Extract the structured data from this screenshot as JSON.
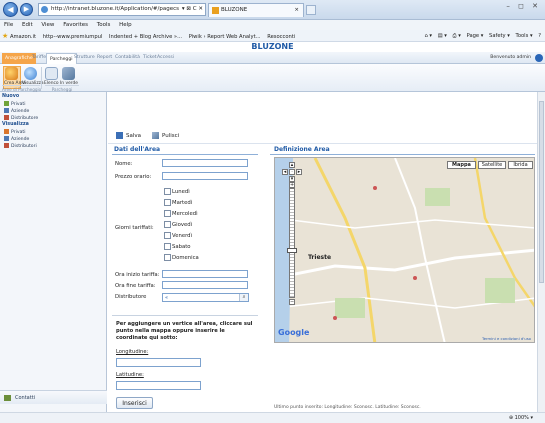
{
  "browser": {
    "address": "http://intranet.bluzone.it/Application/#/pagecs",
    "address_icons": "▾ ⊠ C ✕",
    "tab_title": "BLUZONE",
    "tab_close": "×",
    "window_controls": "– ◻ ✕",
    "menu": [
      "File",
      "Edit",
      "View",
      "Favorites",
      "Tools",
      "Help"
    ],
    "favorites": [
      "Amazon.it",
      "http--www.premiumpul",
      "Indented + Blog Archive »...",
      "Piwik › Report Web Analyt...",
      "Resocconti"
    ],
    "commands": [
      "Page ▾",
      "Safety ▾",
      "Tools ▾"
    ],
    "status_zoom": "⊕ 100% ▾"
  },
  "app": {
    "title": "BLUZONE",
    "ribbon_tabs": [
      "Anagrafiche",
      "Tariffe",
      "Parcheggi",
      "Strutture",
      "Report",
      "Contabilità",
      "Ticket",
      "Accessi"
    ],
    "welcome": "Benvenuto admin",
    "ribbon": {
      "buttons": [
        "Crea Area",
        "Visualizza",
        "Elenco",
        "In verde"
      ],
      "groups": [
        "Aree di Parcheggio",
        "Parcheggi"
      ]
    }
  },
  "sidebar": {
    "sections": [
      {
        "title": "Nuovo",
        "items": [
          "Privati",
          "Aziende",
          "Distributore"
        ]
      },
      {
        "title": "Visualizza",
        "items": [
          "Privati",
          "Aziende",
          "Distributori"
        ]
      }
    ],
    "bottom": "Contatti"
  },
  "toolbar": {
    "save": "Salva",
    "clear": "Pulisci"
  },
  "form": {
    "title": "Dati dell'Area",
    "name_label": "Nome:",
    "price_label": "Prezzo orario:",
    "days_label": "Giorni tariffati:",
    "days": [
      "Lunedì",
      "Martedì",
      "Mercoledì",
      "Giovedì",
      "Venerdì",
      "Sabato",
      "Domenica"
    ],
    "start_label": "Ora inizio tariffa:",
    "end_label": "Ora fine tariffa:",
    "distributor_label": "Distributore",
    "info_text": "Per aggiungere un vertice all'area, cliccare sul punto nella mappa oppure inserire le coordinate qui sotto:",
    "lon_label": "Longitudine:",
    "lat_label": "Latitudine:",
    "insert_button": "Inserisci"
  },
  "map": {
    "title": "Definizione Area",
    "type_buttons": [
      "Mappa",
      "Satellite",
      "Ibrida"
    ],
    "active_type": "Mappa",
    "city": "Trieste",
    "logo": "Google",
    "terms": "Termini e condizioni d'uso",
    "last_point": "Ultimo punto inserito:   Longitudine:   Sconosc.   Latitudine:   Sconosc."
  }
}
